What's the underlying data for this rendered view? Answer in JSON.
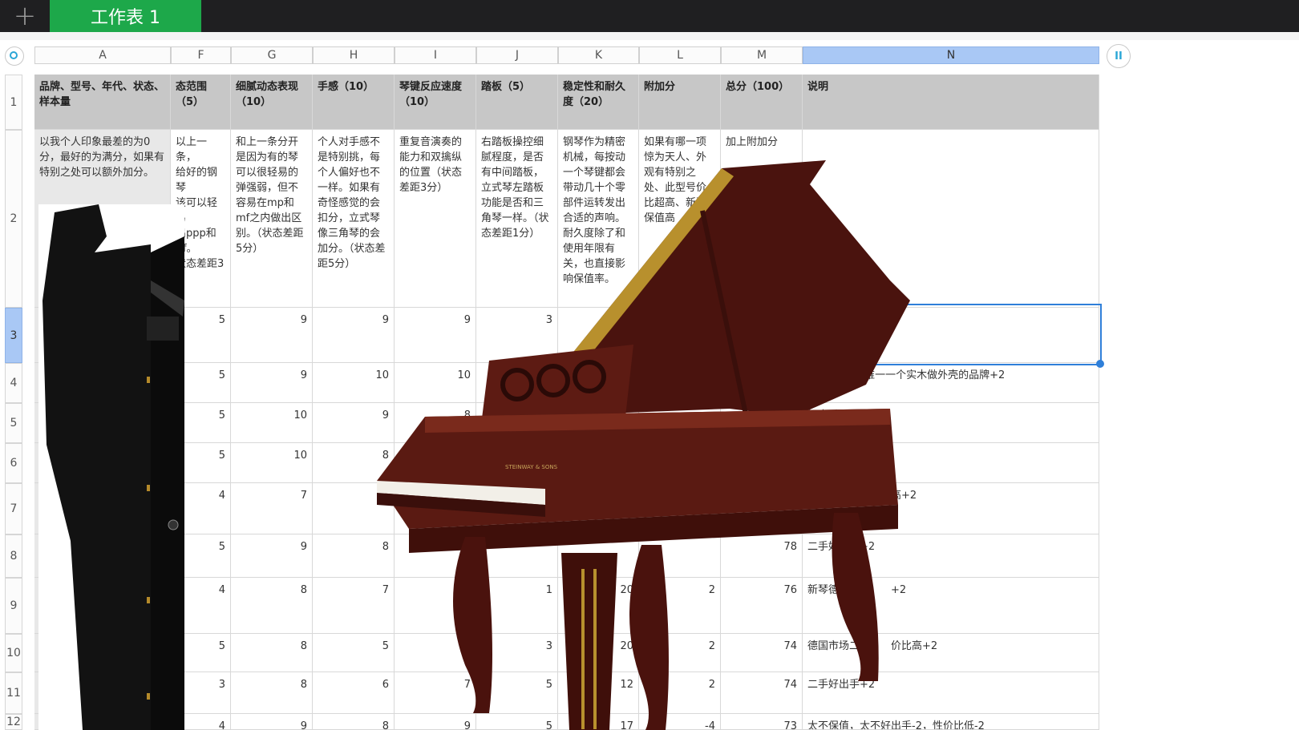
{
  "toolbar": {
    "add_label": "+",
    "sheet_tab_label": "工作表 1",
    "right_button_label": "II"
  },
  "columns": [
    "A",
    "F",
    "G",
    "H",
    "I",
    "J",
    "K",
    "L",
    "M",
    "N"
  ],
  "selected_column": "N",
  "row_numbers": [
    "1",
    "2",
    "3",
    "4",
    "5",
    "6",
    "7",
    "8",
    "9",
    "10",
    "11",
    "12"
  ],
  "selected_row": "3",
  "header_row": {
    "A": "品牌、型号、年代、状态、样本量",
    "F": "态范围（5）",
    "G": "细腻动态表现（10）",
    "H": "手感（10）",
    "I": "琴键反应速度（10）",
    "J": "踏板（5）",
    "K": "稳定性和耐久度（20）",
    "L": "附加分",
    "M": "总分（100）",
    "N": "说明"
  },
  "description_row": {
    "A": "以我个人印象最差的为0分，最好的为满分，如果有特别之处可以额外加分。",
    "F": "以上一条，\n给好的钢琴\n该可以轻易\n出ppp和fff。\n状态差距3",
    "G": "和上一条分开是因为有的琴可以很轻易的弹强弱，但不容易在mp和mf之内做出区别。（状态差距5分）",
    "H": "个人对手感不是特别挑，每个人偏好也不一样。如果有奇怪感觉的会扣分，立式琴像三角琴的会加分。（状态差距5分）",
    "I": "重复音演奏的能力和双擒纵的位置（状态差距3分）",
    "J": "右踏板操控细腻程度，是否有中间踏板，立式琴左踏板功能是否和三角琴一样。（状态差距1分）",
    "K": "钢琴作为精密机械，每按动一个琴键都会带动几十个零部件运转发出合适的声响。耐久度除了和使用年限有关，也直接影响保值率。",
    "L": "如果有哪一项惊为天人、外观有特别之处、此型号价比超高、新琴保值高",
    "M": "加上附加分",
    "N": ""
  },
  "data_rows": [
    {
      "row": "3",
      "F": "5",
      "G": "9",
      "H": "9",
      "I": "9",
      "J": "3",
      "K": "",
      "L": "",
      "M": "",
      "N": "+2，好出手+2"
    },
    {
      "row": "4",
      "F": "5",
      "G": "9",
      "H": "10",
      "I": "10",
      "J": "",
      "K": "",
      "L": "",
      "M": "",
      "N": "别保值+2，唯一一个实木做外壳的品牌+2"
    },
    {
      "row": "5",
      "F": "5",
      "G": "10",
      "H": "9",
      "I": "8",
      "J": "",
      "K": "",
      "L": "",
      "M": "89",
      "N": "好出手+2"
    },
    {
      "row": "6",
      "F": "5",
      "G": "10",
      "H": "8",
      "I": "",
      "J": "",
      "K": "",
      "L": "",
      "M": "",
      "N": ""
    },
    {
      "row": "7",
      "F": "4",
      "G": "7",
      "H": "",
      "I": "",
      "J": "",
      "K": "",
      "L": "",
      "M": "",
      "N": "国二手市场性价比高+2"
    },
    {
      "row": "8",
      "F": "5",
      "G": "9",
      "H": "8",
      "I": "",
      "J": "",
      "K": "",
      "L": "",
      "M": "78",
      "N": "二手好出手+2"
    },
    {
      "row": "9",
      "F": "4",
      "G": "8",
      "H": "7",
      "I": "6",
      "J": "1",
      "K": "20",
      "L": "2",
      "M": "76",
      "N": "新琴德国市场　　+2"
    },
    {
      "row": "10",
      "F": "5",
      "G": "8",
      "H": "5",
      "I": "6",
      "J": "3",
      "K": "20",
      "L": "2",
      "M": "74",
      "N": "德国市场二手　　价比高+2"
    },
    {
      "row": "11",
      "F": "3",
      "G": "8",
      "H": "6",
      "I": "7",
      "J": "5",
      "K": "12",
      "L": "2",
      "M": "74",
      "N": "二手好出手+2"
    },
    {
      "row": "12",
      "F": "4",
      "G": "9",
      "H": "8",
      "I": "9",
      "J": "5",
      "K": "17",
      "L": "-4",
      "M": "73",
      "N": "太不保值，太不好出手-2，性价比低-2"
    }
  ],
  "overlays": {
    "grand_piano_brand": "STEINWAY & SONS"
  },
  "colors": {
    "tab_green": "#1da84a",
    "topbar": "#1f1f21",
    "selection_blue": "#2f7fd9",
    "header_gray": "#c7c7c7",
    "mahogany": "#5a1a12"
  }
}
